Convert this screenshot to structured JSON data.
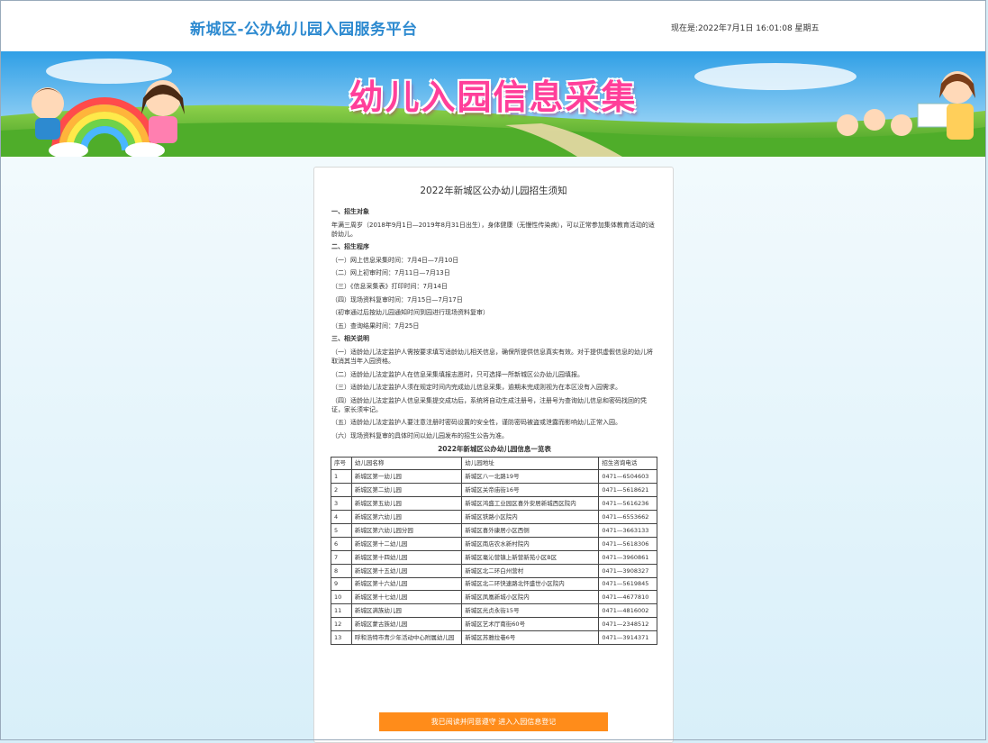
{
  "header": {
    "site_title": "新城区-公办幼儿园入园服务平台",
    "clock_text": "现在是:2022年7月1日 16:01:08 星期五"
  },
  "banner": {
    "title": "幼儿入园信息采集"
  },
  "notice": {
    "title": "2022年新城区公办幼儿园招生须知",
    "paragraphs": [
      {
        "text": "一、招生对象",
        "heading": true
      },
      {
        "text": "年满三周岁（2018年9月1日—2019年8月31日出生），身体健康（无慢性传染病），可以正常参加集体教育活动的适龄幼儿。",
        "heading": false
      },
      {
        "text": "二、招生程序",
        "heading": true
      },
      {
        "text": "（一）网上信息采集时间：7月4日—7月10日",
        "heading": false
      },
      {
        "text": "（二）网上初审时间：7月11日—7月13日",
        "heading": false
      },
      {
        "text": "（三）《信息采集表》打印时间：7月14日",
        "heading": false
      },
      {
        "text": "（四）现场资料复审时间：7月15日—7月17日",
        "heading": false
      },
      {
        "text": "（初审通过后按幼儿园通知时间到园进行现场资料复审）",
        "heading": false
      },
      {
        "text": "（五）查询结果时间：7月25日",
        "heading": false
      },
      {
        "text": "三、相关说明",
        "heading": true
      },
      {
        "text": "（一）适龄幼儿法定监护人需按要求填写适龄幼儿相关信息，确保所提供信息真实有效。对于提供虚假信息的幼儿将取消其当年入园资格。",
        "heading": false
      },
      {
        "text": "（二）适龄幼儿法定监护人在信息采集填报志愿时，只可选择一所新城区公办幼儿园填报。",
        "heading": false
      },
      {
        "text": "（三）适龄幼儿法定监护人须在规定时间内完成幼儿信息采集，逾期未完成则视为在本区没有入园需求。",
        "heading": false
      },
      {
        "text": "（四）适龄幼儿法定监护人信息采集提交成功后，系统将自动生成注册号，注册号为查询幼儿信息和密码找回的凭证，家长须牢记。",
        "heading": false
      },
      {
        "text": "（五）适龄幼儿法定监护人要注意注册时密码设置的安全性，谨防密码被盗或泄露而影响幼儿正常入园。",
        "heading": false
      },
      {
        "text": "（六）现场资料复审的具体时间以幼儿园发布的招生公告为准。",
        "heading": false
      }
    ],
    "table_title": "2022年新城区公办幼儿园信息一览表",
    "table_headers": [
      "序号",
      "幼儿园名称",
      "幼儿园地址",
      "招生咨询电话"
    ],
    "table_rows": [
      [
        "1",
        "新城区第一幼儿园",
        "新城区八一北路19号",
        "0471—6504603"
      ],
      [
        "2",
        "新城区第二幼儿园",
        "新城区关帝庙街16号",
        "0471—5618621"
      ],
      [
        "3",
        "新城区第五幼儿园",
        "新城区鸿盛工业园区喜外安居新城西区院内",
        "0471—5616236"
      ],
      [
        "4",
        "新城区第六幼儿园",
        "新城区铁路小区院内",
        "0471—6553662"
      ],
      [
        "5",
        "新城区第六幼儿园分园",
        "新城区喜外康居小区西侧",
        "0471—3663133"
      ],
      [
        "6",
        "新城区第十二幼儿园",
        "新城区南店农水新村院内",
        "0471—5618306"
      ],
      [
        "7",
        "新城区第十四幼儿园",
        "新城区毫沁营镇上新营新苑小区B区",
        "0471—3960861"
      ],
      [
        "8",
        "新城区第十五幼儿园",
        "新城区北二环白州营村",
        "0471—3908327"
      ],
      [
        "9",
        "新城区第十六幼儿园",
        "新城区北二环快速路北怀盛世小区院内",
        "0471—5619845"
      ],
      [
        "10",
        "新城区第十七幼儿园",
        "新城区凤凰新城小区院内",
        "0471—4677810"
      ],
      [
        "11",
        "新城区满族幼儿园",
        "新城区光贞永街15号",
        "0471—4816002"
      ],
      [
        "12",
        "新城区蒙古族幼儿园",
        "新城区艺术厅南街60号",
        "0471—2348512"
      ],
      [
        "13",
        "呼和浩特市青少年活动中心附属幼儿园",
        "新城区苏雅拉巷6号",
        "0471—3914371"
      ]
    ],
    "cta_label": "我已阅读并同意遵守 进入入园信息登记"
  },
  "colors": {
    "title_blue": "#2d8ad0",
    "banner_pink": "#ff3f9a",
    "cta_orange": "#ff8c1a"
  }
}
